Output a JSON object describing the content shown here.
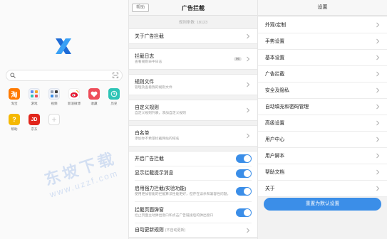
{
  "home": {
    "search": {
      "placeholder": ""
    },
    "apps_row1": [
      {
        "label": "淘宝",
        "glyph": "淘",
        "color": "#ff7a00",
        "icon": "taobao-icon"
      },
      {
        "label": "游戏",
        "glyph": "",
        "color": "#5b8def",
        "icon": "game-icon"
      },
      {
        "label": "视频",
        "glyph": "",
        "color": "#3b3b3b",
        "icon": "video-icon"
      },
      {
        "label": "新浪微博",
        "glyph": "",
        "color": "#f5a623",
        "icon": "weibo-icon"
      },
      {
        "label": "收藏",
        "glyph": "",
        "color": "#ee4d5a",
        "icon": "heart-icon"
      },
      {
        "label": "历史",
        "glyph": "",
        "color": "#2ec4b6",
        "icon": "clock-icon"
      }
    ],
    "apps_row2": [
      {
        "label": "帮助",
        "glyph": "?",
        "color": "#f5b800",
        "icon": "help-icon"
      },
      {
        "label": "京东",
        "glyph": "JD",
        "color": "#e1251b",
        "icon": "jd-icon"
      },
      {
        "label": "",
        "glyph": "+",
        "color": "#dddddd",
        "icon": "add-icon"
      }
    ]
  },
  "adblock": {
    "help_label": "帮助",
    "title": "广告拦截",
    "rule_count": "规则条数: 18123",
    "about": {
      "title": "关于广告拦截"
    },
    "log": {
      "title": "拦截日志",
      "desc": "查看规则命中日志",
      "badge": "96"
    },
    "rules_file": {
      "title": "规则文件",
      "desc": "管理及查看我的规则文件"
    },
    "custom_rules": {
      "title": "自定义规则",
      "desc": "自定义规则列表，添加自定义规则"
    },
    "whitelist": {
      "title": "白名单",
      "desc": "添加你不希望拦截网站的域名"
    },
    "toggles": [
      {
        "title": "开启广告拦截",
        "desc": ""
      },
      {
        "title": "显示拦截提示消息",
        "desc": ""
      },
      {
        "title": "启用强力拦截(实验功能)",
        "desc": "使用更加智能的拦截算法性能更好，但存在误杀和兼容性问题。"
      },
      {
        "title": "拦截页面弹窗",
        "desc": "拦止页面主动弹出窗口和点击广告链接后的弹出窗口"
      }
    ],
    "auto_update": {
      "title": "自动更新规则",
      "sub": "(不自动更新)"
    }
  },
  "settings": {
    "title": "设置",
    "items": [
      "外观/定制",
      "手势设置",
      "基本设置",
      "广告拦截",
      "安全及隐私",
      "自动填充和密码管理",
      "高级设置",
      "用户中心",
      "用户脚本",
      "帮助文档",
      "关于"
    ],
    "reset_label": "重置为默认设置"
  },
  "watermark": {
    "cn": "东坡下载",
    "en": "www.uzzf.com"
  },
  "colors": {
    "accent": "#3b8ee8"
  }
}
